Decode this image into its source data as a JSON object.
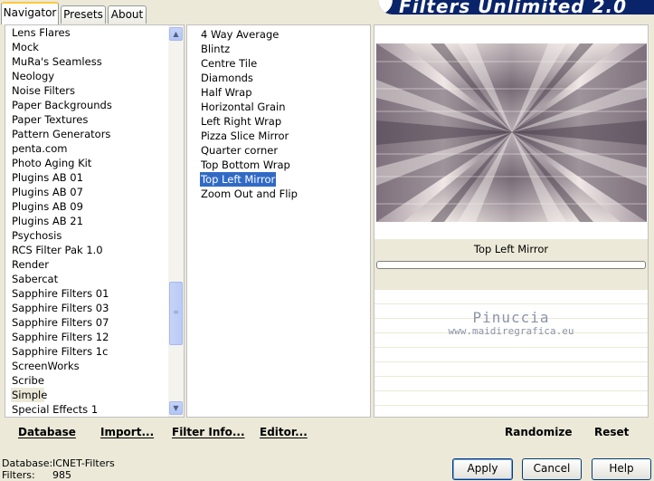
{
  "tabs": [
    {
      "label": "Navigator"
    },
    {
      "label": "Presets"
    },
    {
      "label": "About"
    }
  ],
  "brand": {
    "title": "Filters Unlimited 2.0"
  },
  "categories": [
    "Lens Flares",
    "Mock",
    "MuRa's Seamless",
    "Neology",
    "Noise Filters",
    "Paper Backgrounds",
    "Paper Textures",
    "Pattern Generators",
    "penta.com",
    "Photo Aging Kit",
    "Plugins AB 01",
    "Plugins AB 07",
    "Plugins AB 09",
    "Plugins AB 21",
    "Psychosis",
    "RCS Filter Pak 1.0",
    "Render",
    "Sabercat",
    "Sapphire Filters 01",
    "Sapphire Filters 03",
    "Sapphire Filters 07",
    "Sapphire Filters 12",
    "Sapphire Filters 1c",
    "ScreenWorks",
    "Scribe",
    "Simple",
    "Special Effects 1"
  ],
  "selected_category": "Simple",
  "filters": [
    "4 Way Average",
    "Blintz",
    "Centre Tile",
    "Diamonds",
    "Half Wrap",
    "Horizontal Grain",
    "Left Right Wrap",
    "Pizza Slice Mirror",
    "Quarter corner",
    "Top Bottom Wrap",
    "Top Left Mirror",
    "Zoom Out and Flip"
  ],
  "selected_filter": "Top Left Mirror",
  "preview": {
    "caption": "Top Left Mirror",
    "watermark_line1": "Pinuccia",
    "watermark_line2": "www.maidiregrafica.eu"
  },
  "toolbar": {
    "database": "Database",
    "import": "Import...",
    "filter_info": "Filter Info...",
    "editor": "Editor...",
    "randomize": "Randomize",
    "reset": "Reset"
  },
  "status": {
    "database_label": "Database:",
    "database_value": "ICNET-Filters",
    "filters_label": "Filters:",
    "filters_value": "985"
  },
  "buttons": {
    "apply": "Apply",
    "cancel": "Cancel",
    "help": "Help"
  },
  "icons": {
    "scroll_up": "chevron-up-icon",
    "scroll_down": "chevron-down-icon",
    "scroll_grip": "grip-icon"
  },
  "colors": {
    "selection": "#316ac5",
    "brand_bg": "#0a246a",
    "window_bg": "#ece9d8"
  }
}
